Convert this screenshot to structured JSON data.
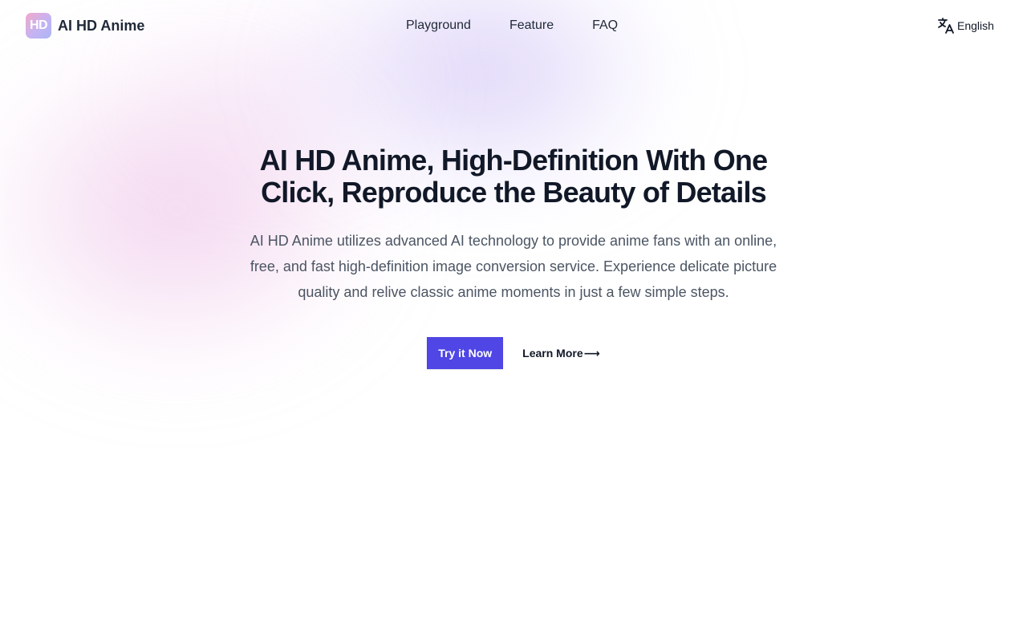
{
  "brand": {
    "logo_text": "HD",
    "name": "AI HD Anime"
  },
  "nav": {
    "items": [
      {
        "label": "Playground"
      },
      {
        "label": "Feature"
      },
      {
        "label": "FAQ"
      }
    ]
  },
  "language": {
    "icon": "translate-icon",
    "label": "English"
  },
  "hero": {
    "title": "AI HD Anime, High-Definition With One Click, Reproduce the Beauty of Details",
    "description": "AI HD Anime utilizes advanced AI technology to provide anime fans with an online, free, and fast high-definition image conversion service. Experience delicate picture quality and relive classic anime moments in just a few simple steps.",
    "primary_button": "Try it Now",
    "secondary_link": "Learn More",
    "secondary_arrow": "⟶"
  },
  "colors": {
    "accent": "#4f46e5",
    "text_primary": "#111827",
    "text_secondary": "#4b5563",
    "logo_gradient_start": "#f2a9c9",
    "logo_gradient_end": "#a9b6f5"
  }
}
